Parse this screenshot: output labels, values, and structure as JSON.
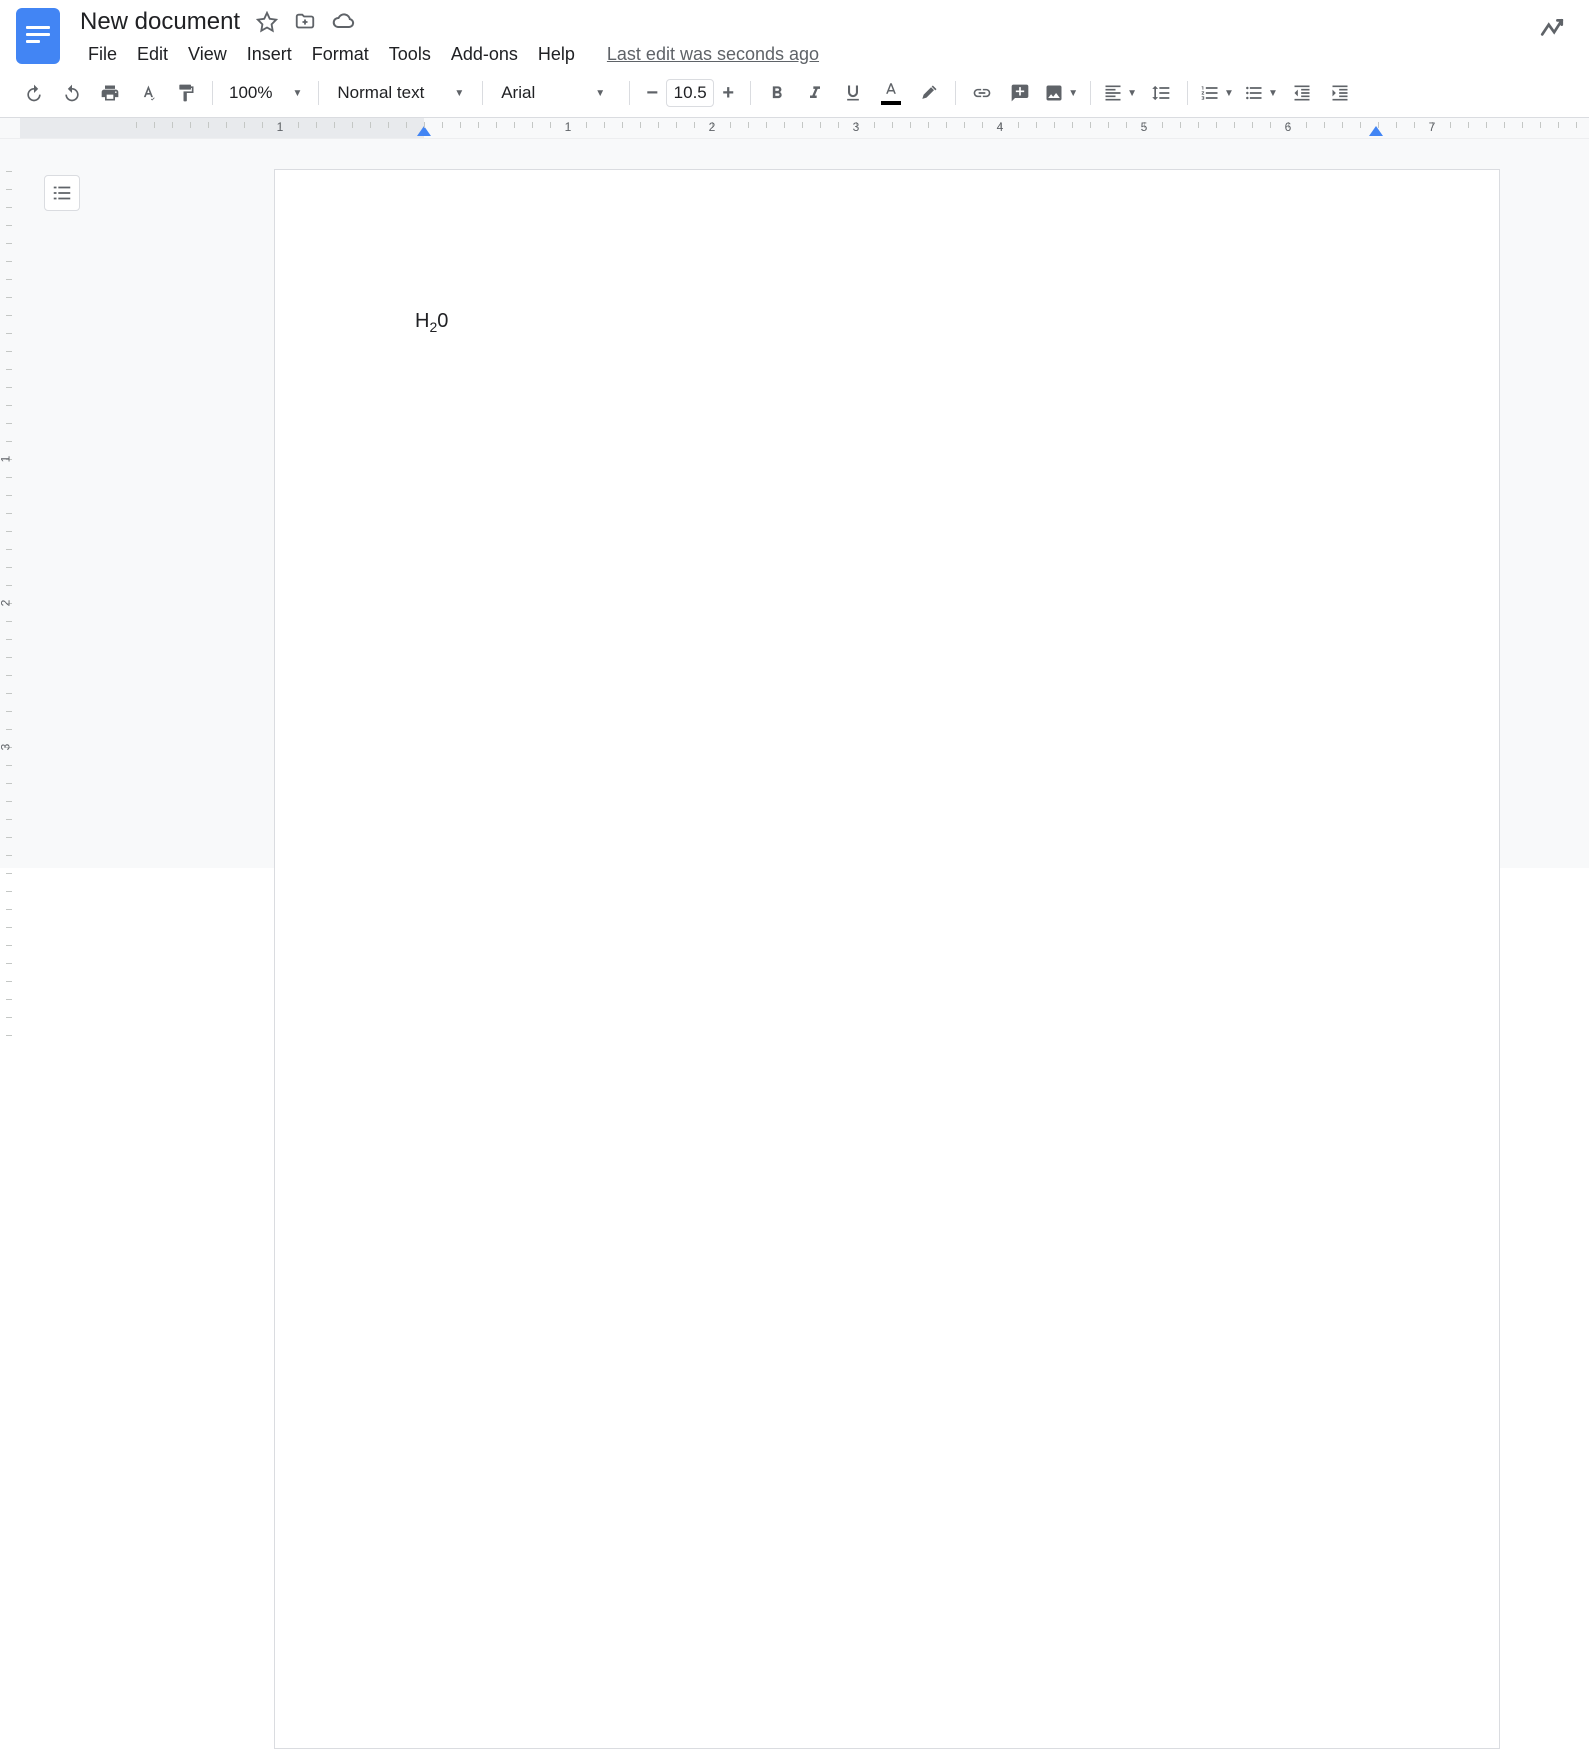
{
  "header": {
    "title": "New document",
    "last_edit": "Last edit was seconds ago"
  },
  "menu": {
    "file": "File",
    "edit": "Edit",
    "view": "View",
    "insert": "Insert",
    "format": "Format",
    "tools": "Tools",
    "addons": "Add-ons",
    "help": "Help"
  },
  "toolbar": {
    "zoom": "100%",
    "style": "Normal text",
    "font": "Arial",
    "font_size": "10.5"
  },
  "ruler": {
    "labels": [
      "1",
      "1",
      "2",
      "3",
      "4",
      "5",
      "6",
      "7"
    ]
  },
  "vruler": {
    "labels": [
      "1",
      "2",
      "3"
    ]
  },
  "document": {
    "content_prefix": "H",
    "content_subscript": "2",
    "content_suffix": "0"
  }
}
